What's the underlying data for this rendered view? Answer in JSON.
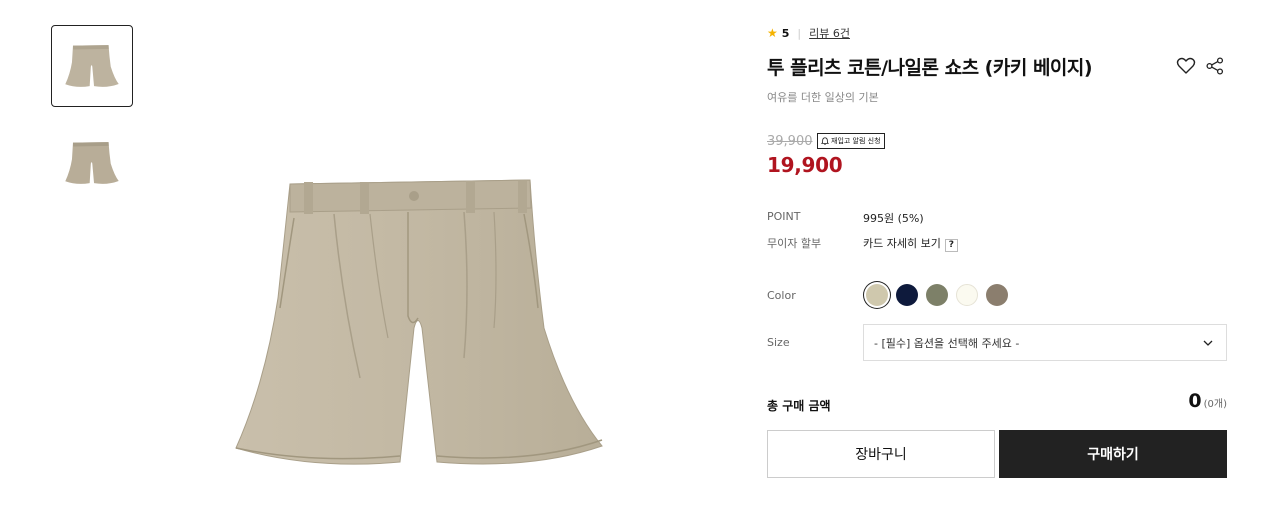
{
  "product": {
    "rating": "5",
    "review_link": "리뷰 6건",
    "title": "투 플리츠 코튼/나일론 쇼츠 (카키 베이지)",
    "subtitle": "여유를 더한 일상의 기본",
    "original_price": "39,900",
    "restock_button": "재입고 알림 신청",
    "sale_price": "19,900"
  },
  "details": {
    "point_label": "POINT",
    "point_value": "995원 (5%)",
    "installment_label": "무이자 할부",
    "installment_value": "카드 자세히 보기",
    "help_mark": "?"
  },
  "options": {
    "color_label": "Color",
    "colors": [
      {
        "name": "khaki-beige",
        "hex": "#cfc8ad",
        "selected": true
      },
      {
        "name": "navy",
        "hex": "#0e1a3c",
        "selected": false
      },
      {
        "name": "olive",
        "hex": "#7d8068",
        "selected": false
      },
      {
        "name": "ivory",
        "hex": "#fbfaf0",
        "selected": false
      },
      {
        "name": "brown-gray",
        "hex": "#8b7e6e",
        "selected": false
      }
    ],
    "size_label": "Size",
    "size_placeholder": "- [필수] 옵션을 선택해 주세요 -"
  },
  "summary": {
    "total_label": "총 구매 금액",
    "total_value": "0",
    "total_count": "(0개)"
  },
  "actions": {
    "cart": "장바구니",
    "buy": "구매하기"
  },
  "colors": {
    "sale_red": "#b0141f",
    "buy_button": "#222222",
    "star": "#f5b301"
  }
}
